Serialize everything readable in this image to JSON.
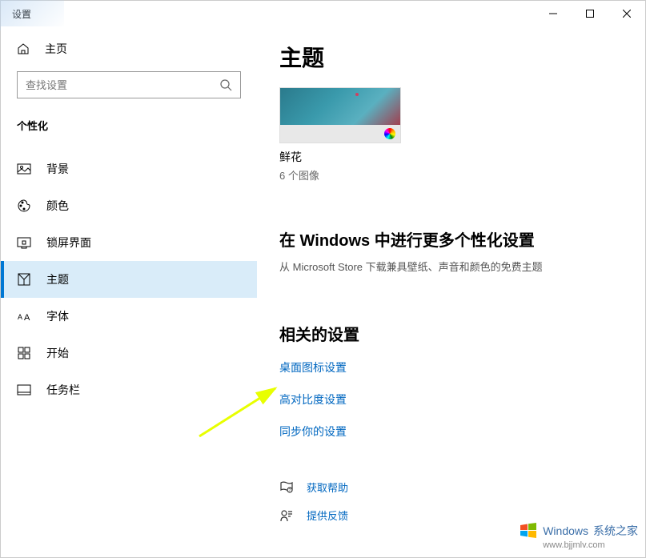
{
  "window": {
    "title": "设置"
  },
  "sidebar": {
    "home": "主页",
    "search_placeholder": "查找设置",
    "section": "个性化",
    "items": [
      {
        "label": "背景"
      },
      {
        "label": "颜色"
      },
      {
        "label": "锁屏界面"
      },
      {
        "label": "主题"
      },
      {
        "label": "字体"
      },
      {
        "label": "开始"
      },
      {
        "label": "任务栏"
      }
    ]
  },
  "main": {
    "title": "主题",
    "theme": {
      "name": "鲜花",
      "image_count": "6 个图像"
    },
    "more": {
      "title": "在 Windows 中进行更多个性化设置",
      "desc": "从 Microsoft Store 下载兼具壁纸、声音和颜色的免费主题"
    },
    "related": {
      "title": "相关的设置",
      "links": [
        "桌面图标设置",
        "高对比度设置",
        "同步你的设置"
      ]
    },
    "help": {
      "get_help": "获取帮助",
      "feedback": "提供反馈"
    }
  },
  "watermark": {
    "brand": "Windows",
    "suffix": "系统之家",
    "url": "www.bjjmlv.com"
  }
}
